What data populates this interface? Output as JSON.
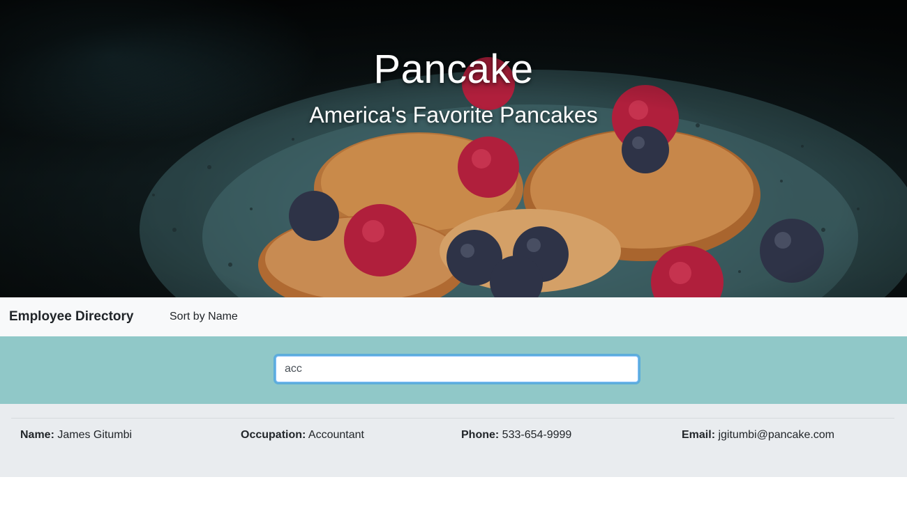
{
  "hero": {
    "title": "Pancake",
    "subtitle": "America's Favorite Pancakes"
  },
  "navbar": {
    "brand": "Employee Directory",
    "sort_label": "Sort by Name"
  },
  "search": {
    "value": "acc",
    "placeholder": ""
  },
  "results": {
    "labels": {
      "name": "Name:",
      "occupation": "Occupation:",
      "phone": "Phone:",
      "email": "Email:"
    },
    "rows": [
      {
        "name": "James Gitumbi",
        "occupation": "Accountant",
        "phone": "533-654-9999",
        "email": "jgitumbi@pancake.com"
      }
    ]
  },
  "colors": {
    "navbar_bg": "#f8f9fa",
    "search_band_bg": "#90c8c8",
    "results_bg": "#e9ecef",
    "focus_ring": "#80bdff"
  }
}
